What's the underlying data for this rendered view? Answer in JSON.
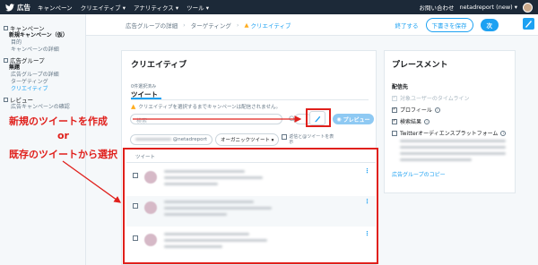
{
  "topbar": {
    "brand": "広告",
    "nav": [
      "キャンペーン",
      "クリエイティブ ▾",
      "アナリティクス ▾",
      "ツール ▾"
    ],
    "help": "お問い合わせ",
    "account": "netadreport (new) ▾"
  },
  "sidebar": {
    "sections": [
      {
        "label": "キャンペーン",
        "items": [
          {
            "label": "新規キャンペーン（仮）",
            "style": "bold"
          },
          {
            "label": "目的",
            "style": "sub"
          },
          {
            "label": "キャンペーンの詳細",
            "style": "sub"
          }
        ]
      },
      {
        "label": "広告グループ",
        "items": [
          {
            "label": "無題",
            "style": "bold"
          },
          {
            "label": "広告グループの詳細",
            "style": "sub"
          },
          {
            "label": "ターゲティング",
            "style": "sub"
          },
          {
            "label": "クリエイティブ",
            "style": "active"
          }
        ]
      },
      {
        "label": "レビュー",
        "items": [
          {
            "label": "広告キャンペーンの確認",
            "style": "sub"
          }
        ]
      }
    ]
  },
  "breadcrumb": {
    "items": [
      "広告グループの詳細",
      "ターゲティング"
    ],
    "current": "クリエイティブ"
  },
  "actions": {
    "finish": "終了する",
    "save_draft": "下書きを保存",
    "next": "次"
  },
  "creative": {
    "title": "クリエイティブ",
    "tab_count": "0件選択済み",
    "tab_label": "ツイート",
    "warning": "クリエイティブを選択するまでキャンペーンは配信されません。",
    "search_placeholder": "検索",
    "preview_label": "プレビュー",
    "chip_account": "@netadreport",
    "chip_organic": "オーガニックツイート ▾",
    "include_label": "返信と@ツイートを表示",
    "list_header": "ツイート"
  },
  "placement": {
    "title": "プレースメント",
    "section": "配信先",
    "options": [
      {
        "label": "対象ユーザーのタイムライン",
        "checked": true,
        "disabled": true
      },
      {
        "label": "プロフィール",
        "checked": true,
        "disabled": false
      },
      {
        "label": "検索結果",
        "checked": true,
        "disabled": false
      },
      {
        "label": "Twitterオーディエンスプラットフォーム",
        "checked": false,
        "disabled": false
      }
    ],
    "link": "広告グループのコピー"
  },
  "annotations": {
    "new_tweet": "新規のツイートを作成",
    "or": "or",
    "existing_tweet": "既存のツイートから選択"
  },
  "colors": {
    "accent": "#1da1f2",
    "annotation": "#e0201c",
    "topbar": "#1c2938"
  }
}
